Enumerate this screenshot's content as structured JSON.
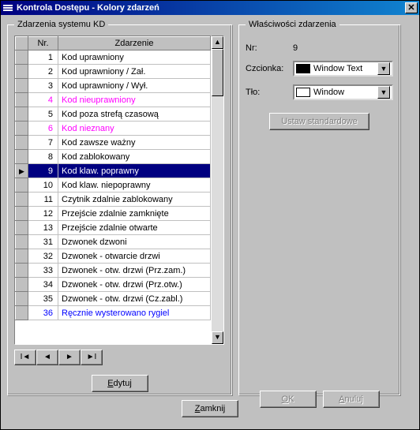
{
  "window_title": "Kontrola Dostępu - Kolory zdarzeń",
  "left_group_title": "Zdarzenia systemu KD",
  "right_group_title": "Właściwości zdarzenia",
  "columns": {
    "nr": "Nr.",
    "event": "Zdarzenie"
  },
  "rows": [
    {
      "nr": "1",
      "text": "Kod uprawniony",
      "color": "#000000"
    },
    {
      "nr": "2",
      "text": "Kod uprawniony / Zał.",
      "color": "#000000"
    },
    {
      "nr": "3",
      "text": "Kod uprawniony / Wył.",
      "color": "#000000"
    },
    {
      "nr": "4",
      "text": "Kod nieuprawniony",
      "color": "#ff00ff"
    },
    {
      "nr": "5",
      "text": "Kod poza strefą czasową",
      "color": "#000000"
    },
    {
      "nr": "6",
      "text": "Kod nieznany",
      "color": "#ff00ff"
    },
    {
      "nr": "7",
      "text": "Kod zawsze ważny",
      "color": "#000000"
    },
    {
      "nr": "8",
      "text": "Kod zablokowany",
      "color": "#000000"
    },
    {
      "nr": "9",
      "text": "Kod klaw. poprawny",
      "color": "#000000",
      "selected": true
    },
    {
      "nr": "10",
      "text": "Kod klaw. niepoprawny",
      "color": "#000000"
    },
    {
      "nr": "11",
      "text": "Czytnik zdalnie zablokowany",
      "color": "#000000"
    },
    {
      "nr": "12",
      "text": "Przejście zdalnie zamknięte",
      "color": "#000000"
    },
    {
      "nr": "13",
      "text": "Przejście zdalnie otwarte",
      "color": "#000000"
    },
    {
      "nr": "31",
      "text": "Dzwonek dzwoni",
      "color": "#000000"
    },
    {
      "nr": "32",
      "text": "Dzwonek - otwarcie drzwi",
      "color": "#000000"
    },
    {
      "nr": "33",
      "text": "Dzwonek - otw. drzwi (Prz.zam.)",
      "color": "#000000"
    },
    {
      "nr": "34",
      "text": "Dzwonek - otw. drzwi (Prz.otw.)",
      "color": "#000000"
    },
    {
      "nr": "35",
      "text": "Dzwonek - otw. drzwi (Cz.zabl.)",
      "color": "#000000"
    },
    {
      "nr": "36",
      "text": "Ręcznie wysterowano rygiel",
      "color": "#0000ff"
    }
  ],
  "buttons": {
    "edit": "Edytuj",
    "ok": "OK",
    "cancel": "Anuluj",
    "close": "Zamknij",
    "defaults": "Ustaw standardowe"
  },
  "props": {
    "nr_label": "Nr:",
    "nr_value": "9",
    "font_label": "Czcionka:",
    "font_value": "Window Text",
    "font_swatch": "#000000",
    "bg_label": "Tło:",
    "bg_value": "Window",
    "bg_swatch": "#ffffff"
  }
}
